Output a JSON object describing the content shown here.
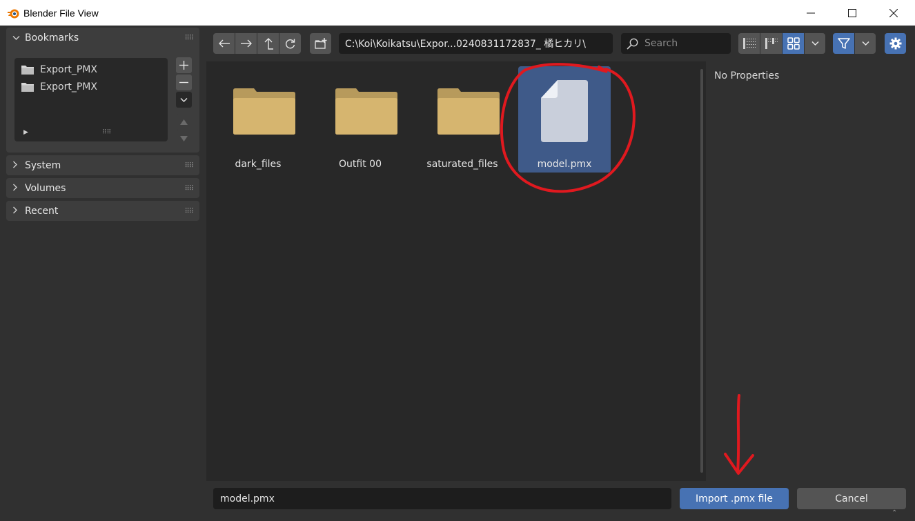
{
  "window": {
    "title": "Blender File View",
    "minimize_icon": "minimize-icon",
    "maximize_icon": "maximize-icon",
    "close_icon": "close-icon"
  },
  "sidebar": {
    "bookmarks": {
      "label": "Bookmarks",
      "items": [
        {
          "label": "Export_PMX",
          "icon": "folder-icon"
        },
        {
          "label": "Export_PMX",
          "icon": "folder-icon"
        }
      ],
      "add_icon": "plus-icon",
      "remove_icon": "minus-icon",
      "menu_icon": "chevron-down-icon",
      "move_up_icon": "triangle-up-icon",
      "move_down_icon": "triangle-down-icon"
    },
    "sections": [
      {
        "label": "System"
      },
      {
        "label": "Volumes"
      },
      {
        "label": "Recent"
      }
    ]
  },
  "toolbar": {
    "path": "C:\\Koi\\Koikatsu\\Expor...0240831172837_ 橘ヒカリ\\",
    "search_placeholder": "Search",
    "icons": [
      "back-arrow-icon",
      "forward-arrow-icon",
      "parent-directory-icon",
      "refresh-icon",
      "new-folder-icon",
      "vertical-list-icon",
      "horizontal-list-icon",
      "thumbnails-icon",
      "display-options-chevron-icon",
      "filter-icon",
      "filter-options-chevron-icon",
      "settings-gear-icon"
    ]
  },
  "files": [
    {
      "name": "dark_files",
      "type": "folder",
      "selected": false
    },
    {
      "name": "Outfit 00",
      "type": "folder",
      "selected": false
    },
    {
      "name": "saturated_files",
      "type": "folder",
      "selected": false
    },
    {
      "name": "model.pmx",
      "type": "file",
      "selected": true
    }
  ],
  "properties": {
    "empty_text": "No Properties"
  },
  "footer": {
    "filename": "model.pmx",
    "import_label": "Import .pmx file",
    "cancel_label": "Cancel"
  },
  "colors": {
    "accent": "#4772b3",
    "selection": "#3f5a89",
    "folder": "#d1b06b",
    "annotation": "#e0191f"
  }
}
